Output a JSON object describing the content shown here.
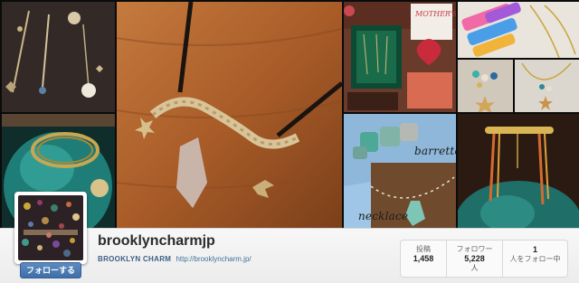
{
  "profile": {
    "username": "brooklyncharmjp",
    "full_name": "BROOKLYN CHARM",
    "website": "http://brooklyncharm.jp/",
    "follow_button_label": "フォローする"
  },
  "stats": {
    "posts": {
      "label": "投稿",
      "value": "1,458"
    },
    "followers": {
      "label": "フォロワー",
      "value": "5,228",
      "unit": "人"
    },
    "following": {
      "label": "人をフォロー中",
      "value": "1"
    }
  },
  "mosaic": {
    "photo_texts": {
      "mothers_day_sign": "MOTHER'S DAY",
      "barrette_label": "barrette",
      "necklace_label": "necklace"
    }
  },
  "colors": {
    "follow_button": "#3e6fa8",
    "link": "#3f729b",
    "profile_bar": "#efefef"
  }
}
